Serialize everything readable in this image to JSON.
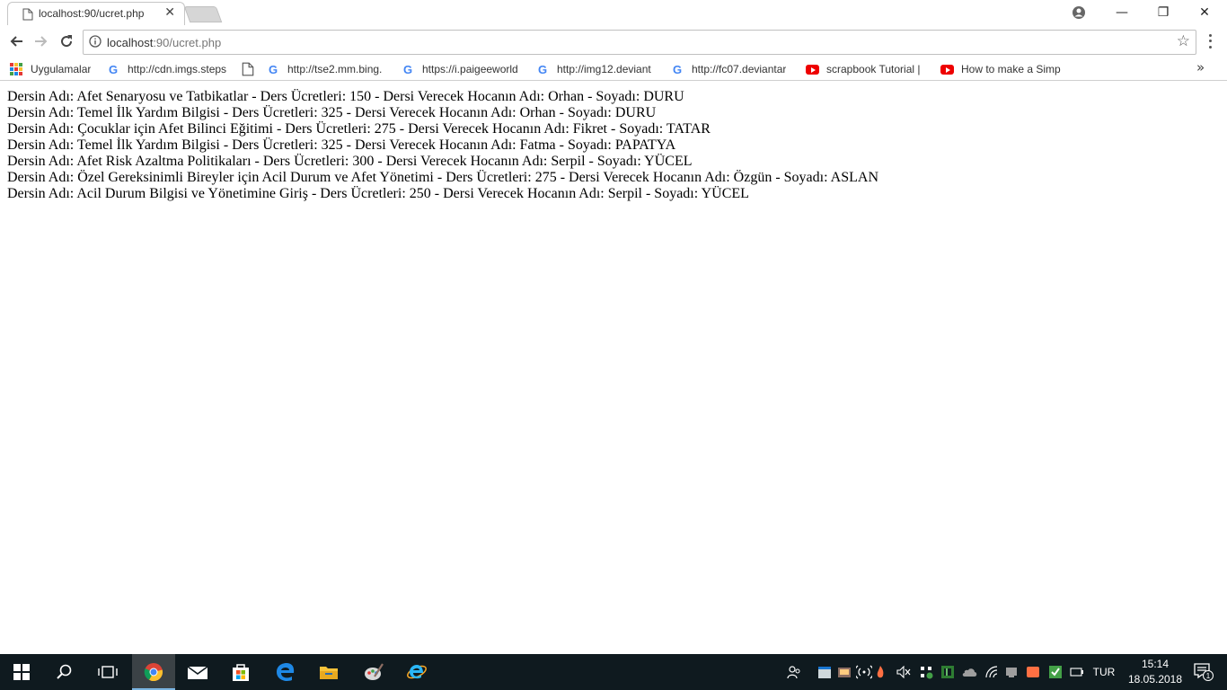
{
  "browser": {
    "tab_title": "localhost:90/ucret.php",
    "tab_close": "✕",
    "url_host": "localhost",
    "url_rest": ":90/ucret.php",
    "window_controls": {
      "minimize": "—",
      "maximize": "❐",
      "close": "✕"
    }
  },
  "bookmarks": [
    {
      "label": "Uygulamalar",
      "icon": "apps-icon"
    },
    {
      "label": "http://cdn.imgs.steps",
      "icon": "google-icon"
    },
    {
      "label": "",
      "icon": "page-icon"
    },
    {
      "label": "http://tse2.mm.bing.",
      "icon": "google-icon"
    },
    {
      "label": "https://i.paigeeworld",
      "icon": "google-icon"
    },
    {
      "label": "http://img12.deviant",
      "icon": "google-icon"
    },
    {
      "label": "http://fc07.deviantar",
      "icon": "google-icon"
    },
    {
      "label": "scrapbook Tutorial |",
      "icon": "youtube-icon"
    },
    {
      "label": "How to make a Simp",
      "icon": "youtube-icon"
    }
  ],
  "bookmarks_overflow": "»",
  "content": {
    "lines": [
      "Dersin Adı: Afet Senaryosu ve Tatbikatlar - Ders Ücretleri: 150 - Dersi Verecek Hocanın Adı: Orhan - Soyadı: DURU",
      "Dersin Adı: Temel İlk Yardım Bilgisi - Ders Ücretleri: 325 - Dersi Verecek Hocanın Adı: Orhan - Soyadı: DURU",
      "Dersin Adı: Çocuklar için Afet Bilinci Eğitimi - Ders Ücretleri: 275 - Dersi Verecek Hocanın Adı: Fikret - Soyadı: TATAR",
      "Dersin Adı: Temel İlk Yardım Bilgisi - Ders Ücretleri: 325 - Dersi Verecek Hocanın Adı: Fatma - Soyadı: PAPATYA",
      "Dersin Adı: Afet Risk Azaltma Politikaları - Ders Ücretleri: 300 - Dersi Verecek Hocanın Adı: Serpil - Soyadı: YÜCEL",
      "Dersin Adı: Özel Gereksinimli Bireyler için Acil Durum ve Afet Yönetimi - Ders Ücretleri: 275 - Dersi Verecek Hocanın Adı: Özgün - Soyadı: ASLAN",
      "Dersin Adı: Acil Durum Bilgisi ve Yönetimine Giriş - Ders Ücretleri: 250 - Dersi Verecek Hocanın Adı: Serpil - Soyadı: YÜCEL"
    ]
  },
  "taskbar": {
    "language": "TUR",
    "time": "15:14",
    "date": "18.05.2018",
    "notification_count": "1"
  }
}
